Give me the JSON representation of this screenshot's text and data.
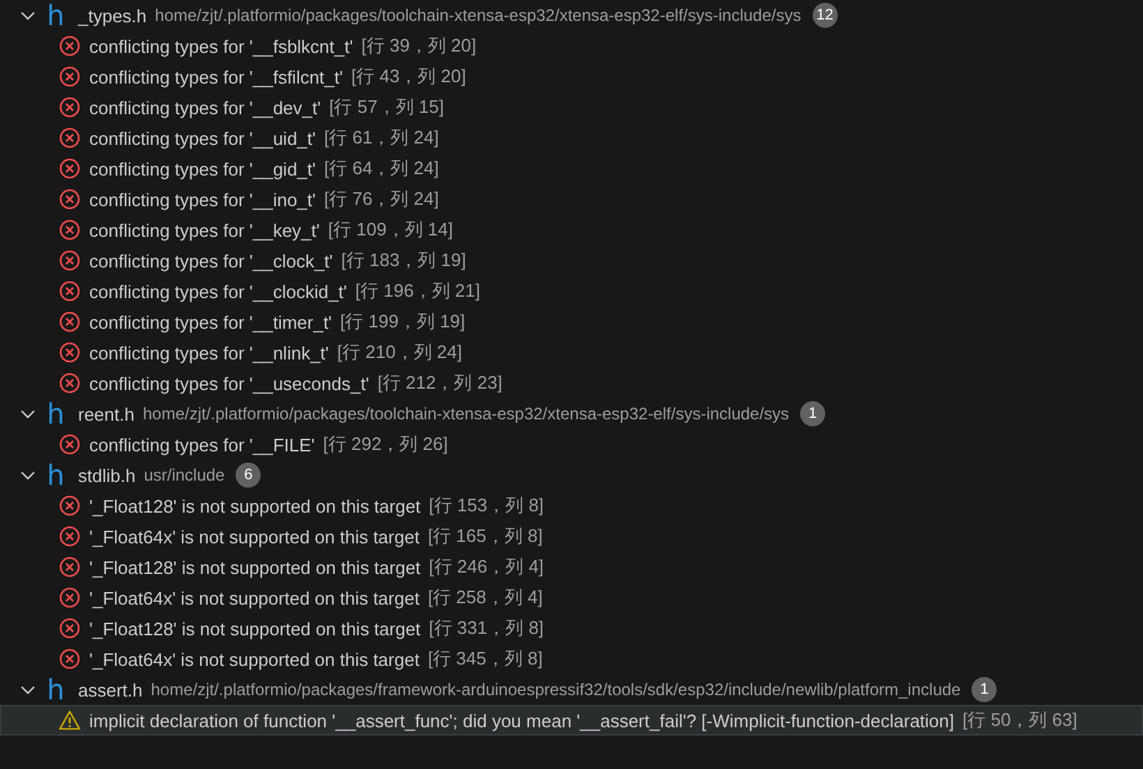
{
  "files": [
    {
      "icon_glyph": "h",
      "name": "_types.h",
      "path": "home/zjt/.platformio/packages/toolchain-xtensa-esp32/xtensa-esp32-elf/sys-include/sys",
      "count": "12",
      "expanded": true,
      "items": [
        {
          "kind": "error",
          "message": "conflicting types for '__fsblkcnt_t'",
          "location": "[行 39，列 20]",
          "selected": false
        },
        {
          "kind": "error",
          "message": "conflicting types for '__fsfilcnt_t'",
          "location": "[行 43，列 20]",
          "selected": false
        },
        {
          "kind": "error",
          "message": "conflicting types for '__dev_t'",
          "location": "[行 57，列 15]",
          "selected": false
        },
        {
          "kind": "error",
          "message": "conflicting types for '__uid_t'",
          "location": "[行 61，列 24]",
          "selected": false
        },
        {
          "kind": "error",
          "message": "conflicting types for '__gid_t'",
          "location": "[行 64，列 24]",
          "selected": false
        },
        {
          "kind": "error",
          "message": "conflicting types for '__ino_t'",
          "location": "[行 76，列 24]",
          "selected": false
        },
        {
          "kind": "error",
          "message": "conflicting types for '__key_t'",
          "location": "[行 109，列 14]",
          "selected": false
        },
        {
          "kind": "error",
          "message": "conflicting types for '__clock_t'",
          "location": "[行 183，列 19]",
          "selected": false
        },
        {
          "kind": "error",
          "message": "conflicting types for '__clockid_t'",
          "location": "[行 196，列 21]",
          "selected": false
        },
        {
          "kind": "error",
          "message": "conflicting types for '__timer_t'",
          "location": "[行 199，列 19]",
          "selected": false
        },
        {
          "kind": "error",
          "message": "conflicting types for '__nlink_t'",
          "location": "[行 210，列 24]",
          "selected": false
        },
        {
          "kind": "error",
          "message": "conflicting types for '__useconds_t'",
          "location": "[行 212，列 23]",
          "selected": false
        }
      ]
    },
    {
      "icon_glyph": "h",
      "name": "reent.h",
      "path": "home/zjt/.platformio/packages/toolchain-xtensa-esp32/xtensa-esp32-elf/sys-include/sys",
      "count": "1",
      "expanded": true,
      "items": [
        {
          "kind": "error",
          "message": "conflicting types for '__FILE'",
          "location": "[行 292，列 26]",
          "selected": false
        }
      ]
    },
    {
      "icon_glyph": "h",
      "name": "stdlib.h",
      "path": "usr/include",
      "count": "6",
      "expanded": true,
      "items": [
        {
          "kind": "error",
          "message": "'_Float128' is not supported on this target",
          "location": "[行 153，列 8]",
          "selected": false
        },
        {
          "kind": "error",
          "message": "'_Float64x' is not supported on this target",
          "location": "[行 165，列 8]",
          "selected": false
        },
        {
          "kind": "error",
          "message": "'_Float128' is not supported on this target",
          "location": "[行 246，列 4]",
          "selected": false
        },
        {
          "kind": "error",
          "message": "'_Float64x' is not supported on this target",
          "location": "[行 258，列 4]",
          "selected": false
        },
        {
          "kind": "error",
          "message": "'_Float128' is not supported on this target",
          "location": "[行 331，列 8]",
          "selected": false
        },
        {
          "kind": "error",
          "message": "'_Float64x' is not supported on this target",
          "location": "[行 345，列 8]",
          "selected": false
        }
      ]
    },
    {
      "icon_glyph": "h",
      "name": "assert.h",
      "path": "home/zjt/.platformio/packages/framework-arduinoespressif32/tools/sdk/esp32/include/newlib/platform_include",
      "count": "1",
      "expanded": true,
      "items": [
        {
          "kind": "warning",
          "message": "implicit declaration of function '__assert_func'; did you mean '__assert_fail'? [-Wimplicit-function-declaration]",
          "location": "[行 50，列 63]",
          "selected": true
        }
      ]
    }
  ]
}
